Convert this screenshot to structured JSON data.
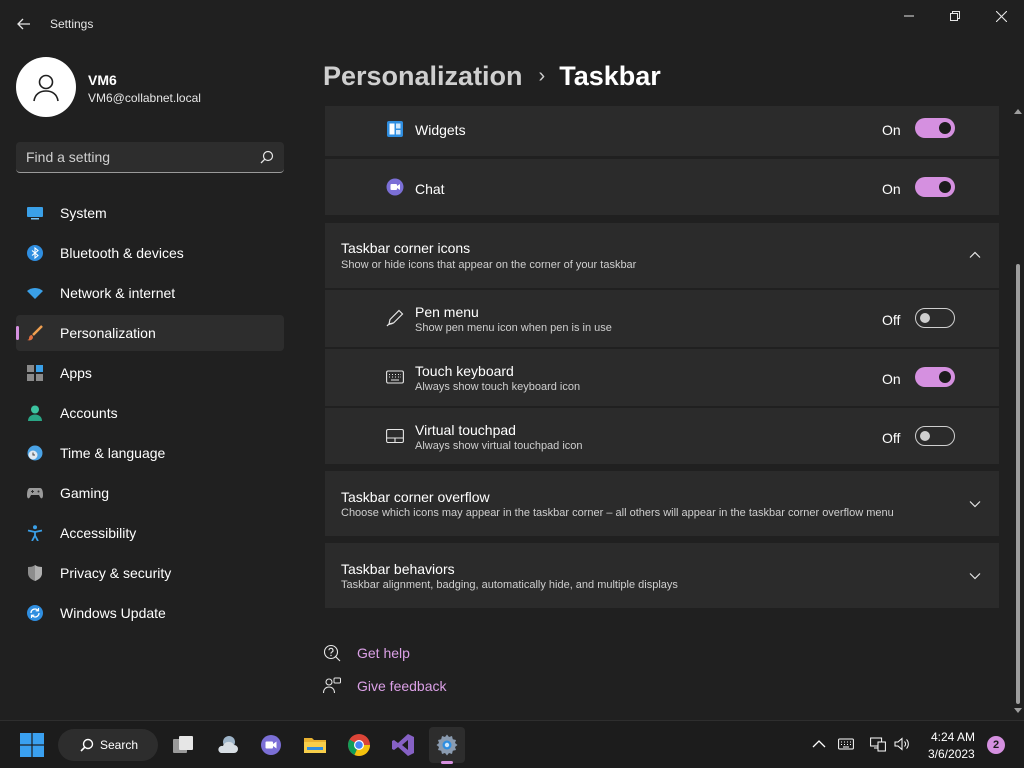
{
  "window": {
    "title": "Settings"
  },
  "profile": {
    "name": "VM6",
    "email": "VM6@collabnet.local"
  },
  "search": {
    "placeholder": "Find a setting"
  },
  "sidebar": {
    "items": [
      {
        "label": "System",
        "icon": "monitor-icon"
      },
      {
        "label": "Bluetooth & devices",
        "icon": "bluetooth-icon"
      },
      {
        "label": "Network & internet",
        "icon": "wifi-icon"
      },
      {
        "label": "Personalization",
        "icon": "paintbrush-icon",
        "selected": true
      },
      {
        "label": "Apps",
        "icon": "apps-icon"
      },
      {
        "label": "Accounts",
        "icon": "person-icon"
      },
      {
        "label": "Time & language",
        "icon": "clock-globe-icon"
      },
      {
        "label": "Gaming",
        "icon": "gamepad-icon"
      },
      {
        "label": "Accessibility",
        "icon": "accessibility-icon"
      },
      {
        "label": "Privacy & security",
        "icon": "shield-icon"
      },
      {
        "label": "Windows Update",
        "icon": "update-icon"
      }
    ]
  },
  "breadcrumb": {
    "parent": "Personalization",
    "separator": "›",
    "current": "Taskbar"
  },
  "taskbar_items": {
    "widgets": {
      "label": "Widgets",
      "state": "On",
      "on": true,
      "icon": "widgets-icon"
    },
    "chat": {
      "label": "Chat",
      "state": "On",
      "on": true,
      "icon": "chat-icon"
    }
  },
  "corner_icons": {
    "title": "Taskbar corner icons",
    "description": "Show or hide icons that appear on the corner of your taskbar",
    "expanded": true,
    "items": [
      {
        "label": "Pen menu",
        "description": "Show pen menu icon when pen is in use",
        "state": "Off",
        "on": false,
        "icon": "pen-icon"
      },
      {
        "label": "Touch keyboard",
        "description": "Always show touch keyboard icon",
        "state": "On",
        "on": true,
        "icon": "keyboard-icon"
      },
      {
        "label": "Virtual touchpad",
        "description": "Always show virtual touchpad icon",
        "state": "Off",
        "on": false,
        "icon": "touchpad-icon"
      }
    ]
  },
  "corner_overflow": {
    "title": "Taskbar corner overflow",
    "description": "Choose which icons may appear in the taskbar corner – all others will appear in the taskbar corner overflow menu"
  },
  "behaviors": {
    "title": "Taskbar behaviors",
    "description": "Taskbar alignment, badging, automatically hide, and multiple displays"
  },
  "help": {
    "get_help": "Get help",
    "give_feedback": "Give feedback"
  },
  "taskbar": {
    "search_label": "Search",
    "time": "4:24 AM",
    "date": "3/6/2023",
    "notification_count": "2"
  },
  "colors": {
    "accent": "#d590e0",
    "background": "#202020",
    "card": "#2b2b2b"
  }
}
